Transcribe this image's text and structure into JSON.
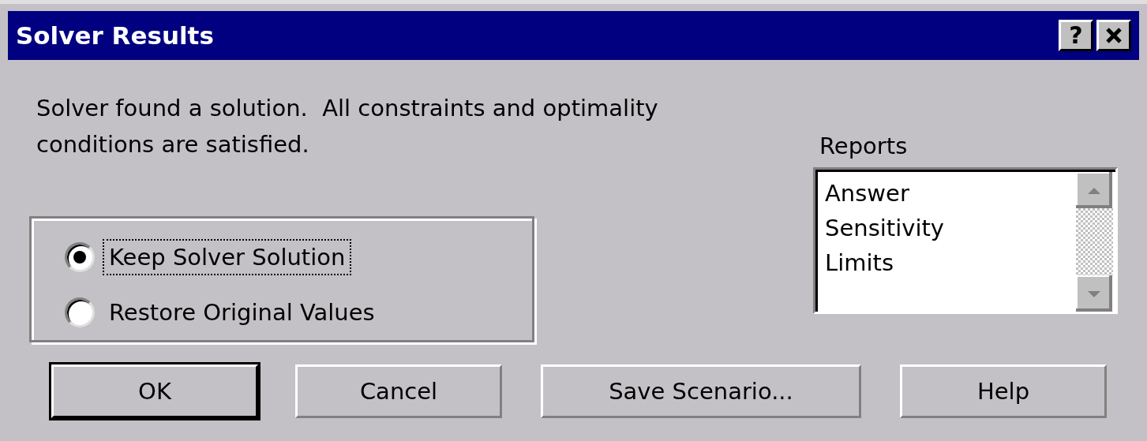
{
  "window": {
    "title": "Solver Results",
    "buttons": [
      {
        "kind": "help",
        "label": "?"
      },
      {
        "kind": "close"
      }
    ]
  },
  "message": "Solver found a solution.  All constraints and optimality conditions are satisfied.",
  "options": [
    {
      "label": "Keep Solver Solution",
      "selected": true,
      "focused": true
    },
    {
      "label": "Restore Original Values",
      "selected": false,
      "focused": false
    }
  ],
  "reports": {
    "label": "Reports",
    "items": [
      "Answer",
      "Sensitivity",
      "Limits"
    ]
  },
  "buttons": [
    {
      "label": "OK",
      "default": true
    },
    {
      "label": "Cancel",
      "default": false
    },
    {
      "label": "Save Scenario...",
      "default": false
    },
    {
      "label": "Help",
      "default": false
    }
  ]
}
